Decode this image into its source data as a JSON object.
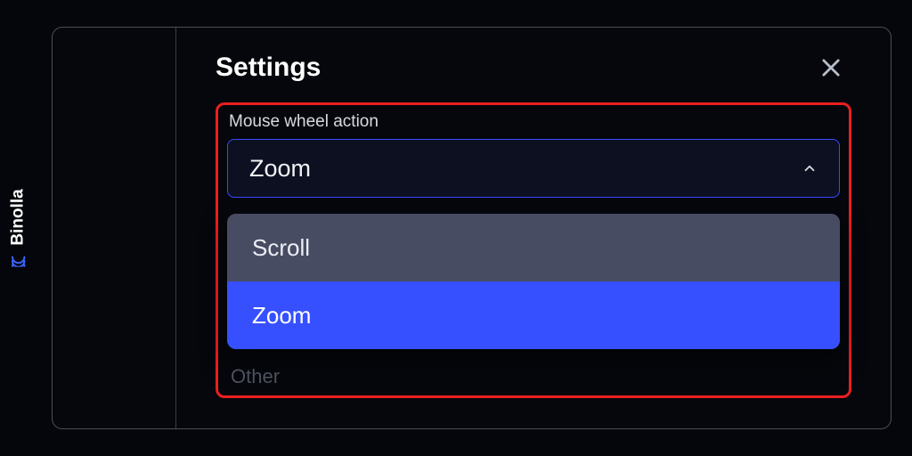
{
  "brand": {
    "name": "Binolla"
  },
  "panel": {
    "title": "Settings",
    "field_label": "Mouse wheel action",
    "selected_value": "Zoom",
    "options": {
      "scroll": "Scroll",
      "zoom": "Zoom"
    },
    "ghost": "Other"
  }
}
